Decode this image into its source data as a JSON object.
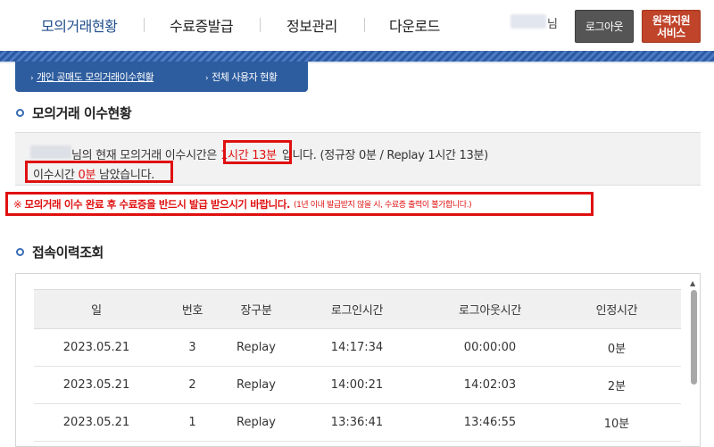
{
  "nav": {
    "items": [
      {
        "label": "모의거래현황",
        "active": true
      },
      {
        "label": "수료증발급",
        "active": false
      },
      {
        "label": "정보관리",
        "active": false
      },
      {
        "label": "다운로드",
        "active": false
      }
    ],
    "user_suffix": "님",
    "logout_label": "로그아웃",
    "remote_label": "원격지원\n서비스"
  },
  "subtabs": [
    {
      "label": "개인 공매도 모의거래이수현황",
      "active": true
    },
    {
      "label": "전체 사용자 현황",
      "active": false
    }
  ],
  "status": {
    "title": "모의거래 이수현황",
    "line1_prefix": "님의 현재 모의거래 이수시간은",
    "line1_time": "1시간 13분",
    "line1_suffix": "입니다. (정규장 0분 / Replay 1시간 13분)",
    "line2_prefix": "이수시간 ",
    "line2_remaining": "0분",
    "line2_suffix": " 남았습니다."
  },
  "notice": {
    "mark": "※",
    "main": "모의거래 이수 완료 후 수료증을 반드시 발급 받으시기 바랍니다.",
    "detail": "(1년 이내 발급받지 않을 시, 수료증 출력이 불가합니다.)"
  },
  "history": {
    "title": "접속이력조회",
    "columns": [
      "일",
      "번호",
      "장구분",
      "로그인시간",
      "로그아웃시간",
      "인정시간"
    ],
    "rows": [
      [
        "2023.05.21",
        "3",
        "Replay",
        "14:17:34",
        "00:00:00",
        "0분"
      ],
      [
        "2023.05.21",
        "2",
        "Replay",
        "14:00:21",
        "14:02:03",
        "2분"
      ],
      [
        "2023.05.21",
        "1",
        "Replay",
        "13:36:41",
        "13:46:55",
        "10분"
      ]
    ]
  },
  "colors": {
    "accent": "#1f4e8c",
    "highlight_red": "#e01010",
    "remote_button": "#c0442a",
    "logout_button": "#555555"
  }
}
